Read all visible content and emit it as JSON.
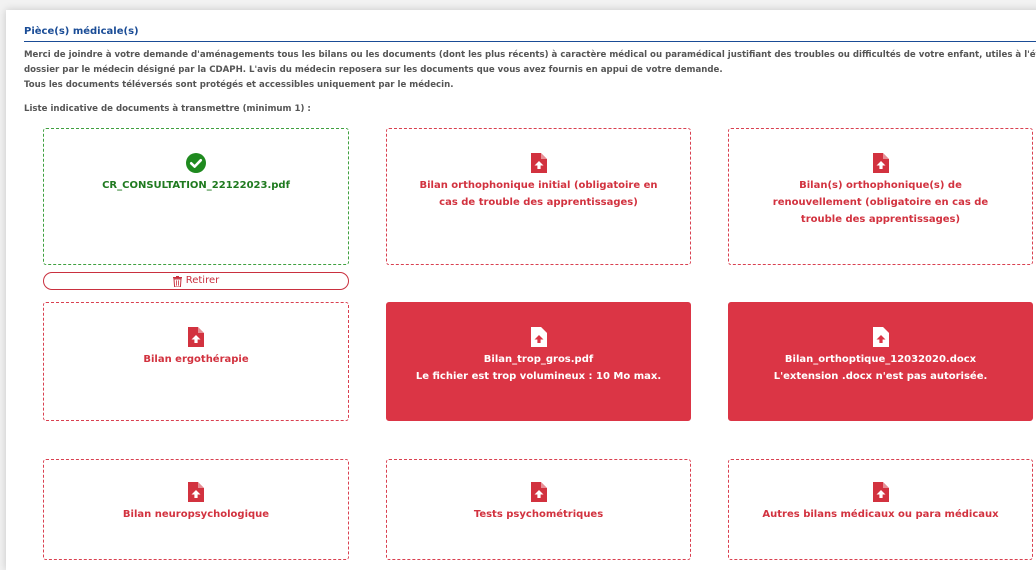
{
  "section": {
    "title": "Pièce(s) médicale(s)",
    "intro_lines": [
      "Merci de joindre à votre demande d'aménagements tous les bilans ou les documents (dont les plus récents) à caractère médical ou paramédical justifiant des troubles ou difficultés de votre enfant, utiles à l'étude du",
      "dossier par le médecin désigné par la CDAPH. L'avis du médecin reposera sur les documents que vous avez fournis en appui de votre demande.",
      "Tous les documents téléversés sont protégés et accessibles uniquement par le médecin."
    ],
    "list_label": "Liste indicative de documents à transmettre (minimum 1) :"
  },
  "cards": {
    "uploaded": {
      "filename": "CR_CONSULTATION_22122023.pdf",
      "icon": "check-circle-icon",
      "status": "success"
    },
    "remove_label": "Retirer",
    "ortho_initial": {
      "label_line1": "Bilan orthophonique initial (obligatoire en",
      "label_line2": "cas de trouble des apprentissages)",
      "icon": "file-upload-icon"
    },
    "ortho_renouv": {
      "label_line1": "Bilan(s) orthophonique(s) de",
      "label_line2": "renouvellement (obligatoire en cas de",
      "label_line3": "trouble des apprentissages)",
      "icon": "file-upload-icon"
    },
    "ergo": {
      "label": "Bilan ergothérapie",
      "icon": "file-upload-icon"
    },
    "trop_gros": {
      "filename": "Bilan_trop_gros.pdf",
      "error": "Le fichier est trop volumineux : 10 Mo max.",
      "icon": "file-upload-icon",
      "status": "error"
    },
    "orthoptique": {
      "filename": "Bilan_orthoptique_12032020.docx",
      "error": "L'extension .docx n'est pas autorisée.",
      "icon": "file-upload-icon",
      "status": "error"
    },
    "neuro": {
      "label": "Bilan neuropsychologique",
      "icon": "file-upload-icon"
    },
    "psycho": {
      "label": "Tests psychométriques",
      "icon": "file-upload-icon"
    },
    "autres": {
      "label": "Autres bilans médicaux ou para médicaux",
      "icon": "file-upload-icon"
    }
  },
  "colors": {
    "accent_blue": "#1a4c96",
    "error_red": "#db3545",
    "success_green": "#1f7a1f"
  }
}
